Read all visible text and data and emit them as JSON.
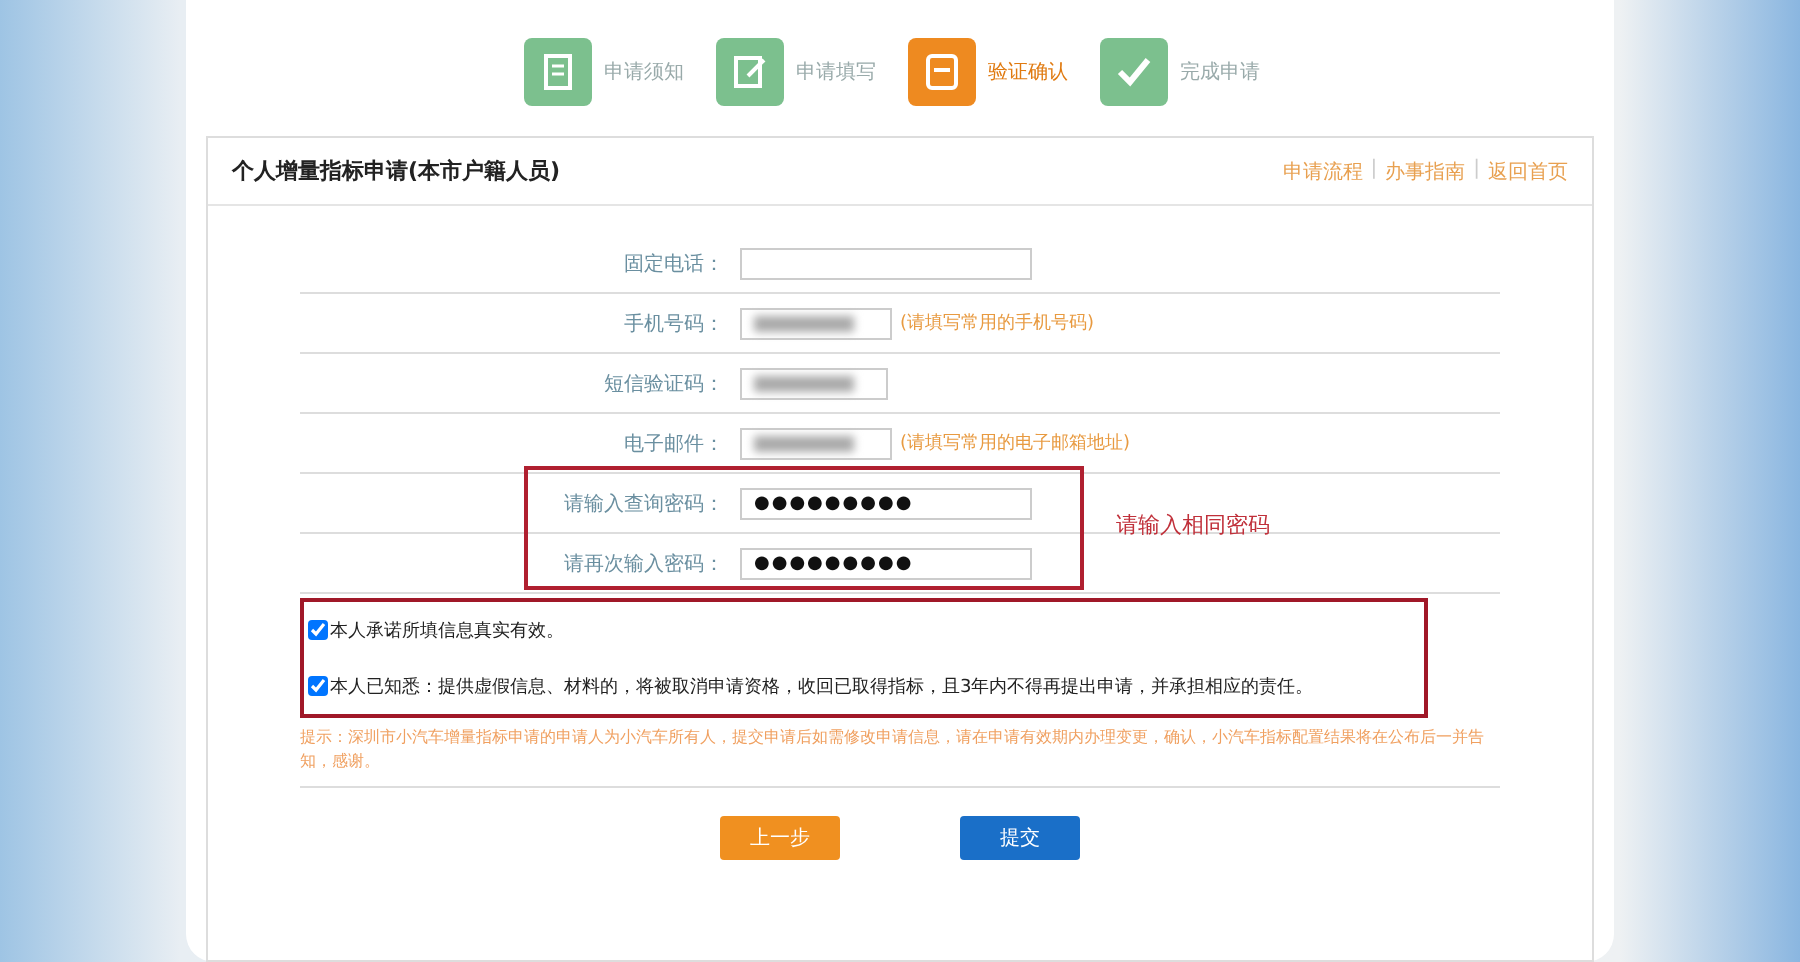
{
  "steps": [
    {
      "label": "申请须知",
      "selected": false
    },
    {
      "label": "申请填写",
      "selected": false
    },
    {
      "label": "验证确认",
      "selected": true
    },
    {
      "label": "完成申请",
      "selected": false
    }
  ],
  "section": {
    "title": "个人增量指标申请(本市户籍人员)",
    "links": [
      "申请流程",
      "办事指南",
      "返回首页"
    ],
    "separator": "|"
  },
  "fields": [
    {
      "label": "固定电话：",
      "kind": "text"
    },
    {
      "label": "手机号码：",
      "kind": "masked",
      "hint": "(请填写常用的手机号码)"
    },
    {
      "label": "短信验证码：",
      "kind": "masked"
    },
    {
      "label": "电子邮件：",
      "kind": "masked",
      "hint": "(请填写常用的电子邮箱地址)"
    }
  ],
  "password_fields": [
    {
      "label": "请输入查询密码：",
      "value": "●●●●●●●●●"
    },
    {
      "label": "请再次输入密码：",
      "value": "●●●●●●●●●"
    }
  ],
  "annotation": "请输入相同密码",
  "pledges": [
    {
      "text": "本人承诺所填信息真实有效。",
      "checked": true
    },
    {
      "text": "本人已知悉：提供虚假信息、材料的，将被取消申请资格，收回已取得指标，且3年内不得再提出申请，并承担相应的责任。",
      "checked": true
    }
  ],
  "notice": "提示：深圳市小汽车增量指标申请的申请人为小汽车所有人，提交申请后如需修改申请信息，请在申请有效期内办理变更，确认，小汽车指标配置结果将在公布后一并告知，感谢。",
  "buttons": [
    {
      "label": "上一步",
      "kind": "secondary"
    },
    {
      "label": "提交",
      "kind": "primary"
    }
  ]
}
